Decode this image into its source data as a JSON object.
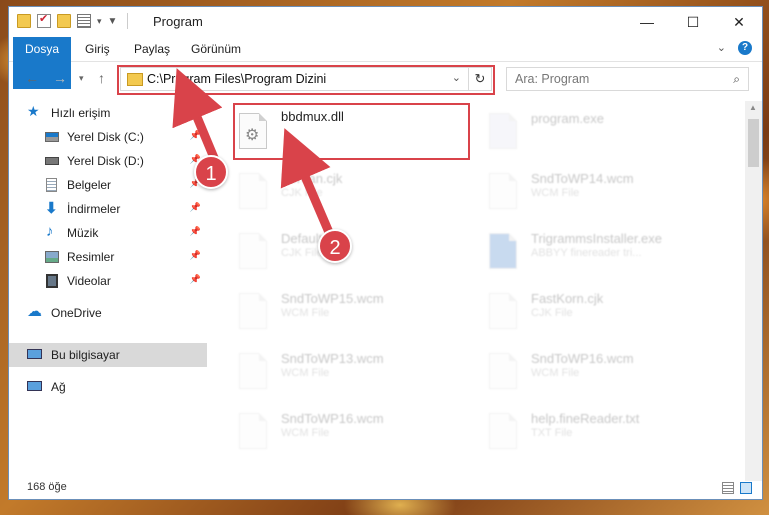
{
  "window": {
    "title": "Program"
  },
  "ribbon": {
    "tabs": [
      "Dosya",
      "Giriş",
      "Paylaş",
      "Görünüm"
    ]
  },
  "nav": {
    "address": "C:\\Program Files\\Program Dizini",
    "search_placeholder": "Ara: Program"
  },
  "sidebar": {
    "items": [
      {
        "label": "Hızlı erişim",
        "icon": "star-icon"
      },
      {
        "label": "Yerel Disk (C:)",
        "icon": "windows-drive-icon",
        "pinned": true
      },
      {
        "label": "Yerel Disk (D:)",
        "icon": "drive-icon",
        "pinned": true
      },
      {
        "label": "Belgeler",
        "icon": "documents-icon",
        "pinned": true
      },
      {
        "label": "İndirmeler",
        "icon": "download-icon",
        "pinned": true
      },
      {
        "label": "Müzik",
        "icon": "music-icon",
        "pinned": true
      },
      {
        "label": "Resimler",
        "icon": "pictures-icon",
        "pinned": true
      },
      {
        "label": "Videolar",
        "icon": "videos-icon",
        "pinned": true
      },
      {
        "label": "OneDrive",
        "icon": "onedrive-icon"
      },
      {
        "label": "Bu bilgisayar",
        "icon": "computer-icon",
        "selected": true
      },
      {
        "label": "Ağ",
        "icon": "network-icon"
      }
    ]
  },
  "files": [
    {
      "name": "bbdmux.dll",
      "type": "",
      "highlighted": true
    },
    {
      "name": "program.exe",
      "type": "",
      "faded": true
    },
    {
      "name": "Korean.cjk",
      "type": "CJK File",
      "faded": true
    },
    {
      "name": "SndToWP14.wcm",
      "type": "WCM File",
      "faded": true
    },
    {
      "name": "Default.cjk",
      "type": "CJK File",
      "faded": true
    },
    {
      "name": "TrigrammsInstaller.exe",
      "type": "ABBYY finereader tri...",
      "faded": true
    },
    {
      "name": "SndToWP15.wcm",
      "type": "WCM File",
      "faded": true
    },
    {
      "name": "FastKorn.cjk",
      "type": "CJK File",
      "faded": true
    },
    {
      "name": "SndToWP13.wcm",
      "type": "WCM File",
      "faded": true
    },
    {
      "name": "SndToWP16.wcm",
      "type": "WCM File",
      "faded": true
    },
    {
      "name": "SndToWP16.wcm",
      "type": "WCM File",
      "faded": true
    },
    {
      "name": "help.fineReader.txt",
      "type": "TXT File",
      "faded": true
    }
  ],
  "status": {
    "item_count": "168 öğe"
  },
  "annotations": {
    "step1": "1",
    "step2": "2"
  },
  "colors": {
    "accent": "#1979ca",
    "highlight": "#d9434a"
  }
}
